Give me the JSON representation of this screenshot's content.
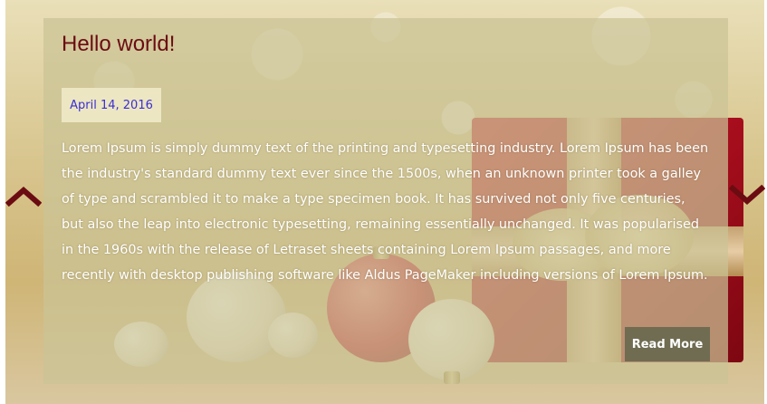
{
  "post": {
    "title": "Hello world!",
    "date": "April 14, 2016",
    "excerpt": "Lorem Ipsum is simply dummy text of the printing and typesetting industry. Lorem Ipsum has been the industry's standard dummy text ever since the 1500s, when an unknown printer took a galley of type and scrambled it to make a type specimen book. It has survived not only five centuries, but also the leap into electronic typesetting, remaining essentially unchanged. It was popularised in the 1960s with the release of Letraset sheets containing Lorem Ipsum passages, and more recently with desktop publishing software like Aldus PageMaker including versions of Lorem Ipsum.",
    "read_more_label": "Read More"
  },
  "controls": {
    "prev_icon": "chevron-up-icon",
    "next_icon": "chevron-down-icon"
  },
  "colors": {
    "title": "#6b0c12",
    "date": "#3b2fd1",
    "arrows": "#6b0c12",
    "button": "#6f6c52"
  }
}
